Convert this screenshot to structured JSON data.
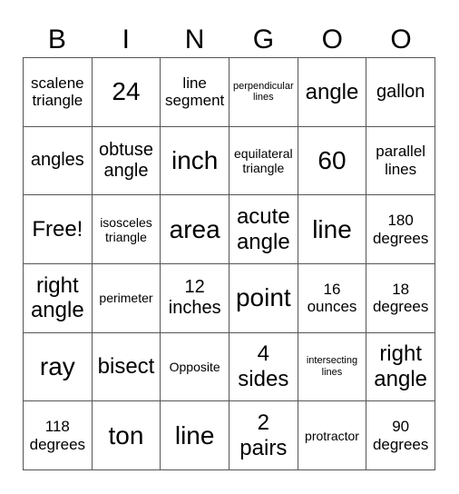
{
  "header": [
    "B",
    "I",
    "N",
    "G",
    "O",
    "O"
  ],
  "cells": [
    [
      "scalene triangle",
      "24",
      "line segment",
      "perpendicular lines",
      "angle",
      "gallon"
    ],
    [
      "angles",
      "obtuse angle",
      "inch",
      "equilateral triangle",
      "60",
      "parallel lines"
    ],
    [
      "Free!",
      "isosceles triangle",
      "area",
      "acute angle",
      "line",
      "180 degrees"
    ],
    [
      "right angle",
      "perimeter",
      "12 inches",
      "point",
      "16 ounces",
      "18 degrees"
    ],
    [
      "ray",
      "bisect",
      "Opposite",
      "4 sides",
      "intersecting lines",
      "right angle"
    ],
    [
      "118 degrees",
      "ton",
      "line",
      "2 pairs",
      "protractor",
      "90 degrees"
    ]
  ]
}
